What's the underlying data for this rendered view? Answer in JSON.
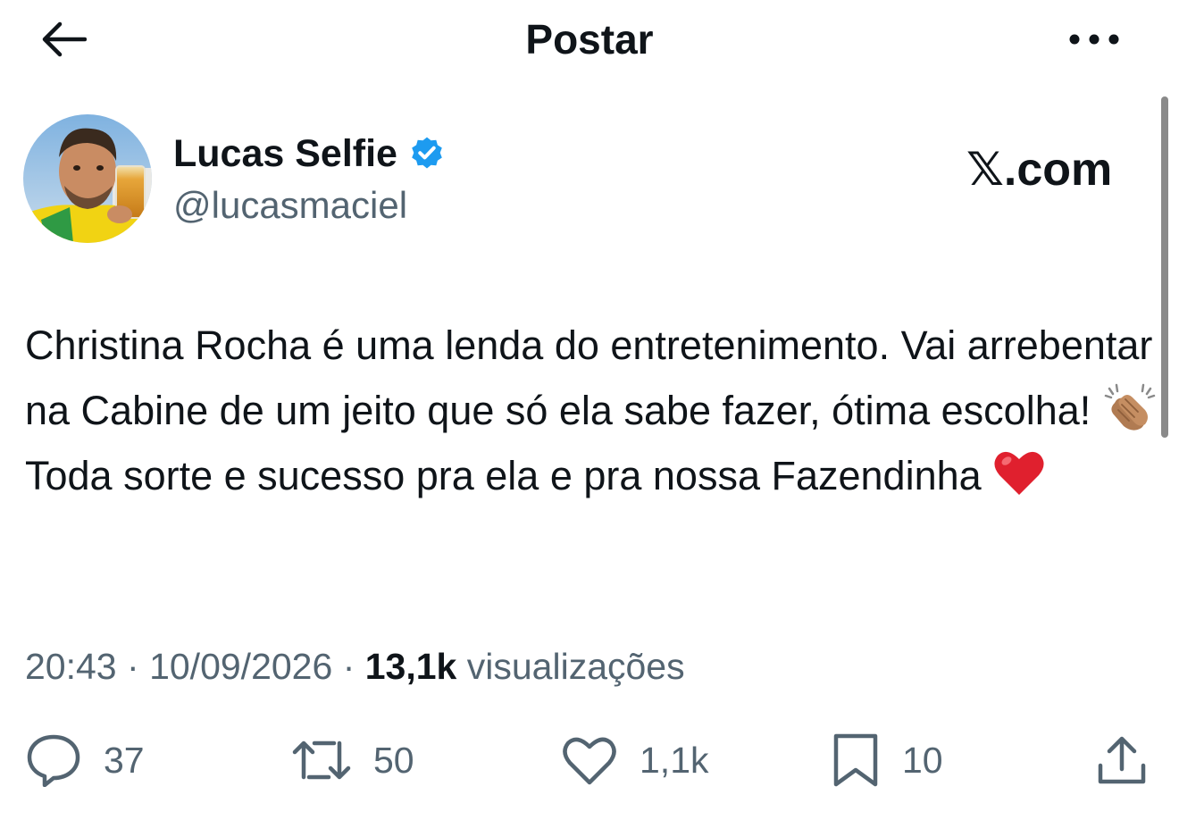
{
  "header": {
    "title": "Postar",
    "back_icon": "arrow-left-icon",
    "more_icon": "more-horizontal-icon"
  },
  "author": {
    "display_name": "Lucas Selfie",
    "handle": "@lucasmaciel",
    "verified": true
  },
  "source_logo": "𝕏.com",
  "tweet": {
    "line1": "Christina Rocha é uma lenda do entretenimento. Vai arrebentar na Cabine de um jeito que só ela sabe fazer, ótima escolha! ",
    "line2": " Toda sorte e sucesso pra ela e pra nossa Fazendinha "
  },
  "meta": {
    "time": "20:43",
    "separator": "·",
    "date": "10/09/2026",
    "views_count": "13,1k",
    "views_label": "visualizações"
  },
  "actions": {
    "replies": "37",
    "reposts": "50",
    "likes": "1,1k",
    "bookmarks": "10"
  },
  "colors": {
    "text": "#0f1419",
    "secondary": "#536471",
    "verified": "#1d9bf0",
    "heart_emoji": "#e0202e"
  }
}
